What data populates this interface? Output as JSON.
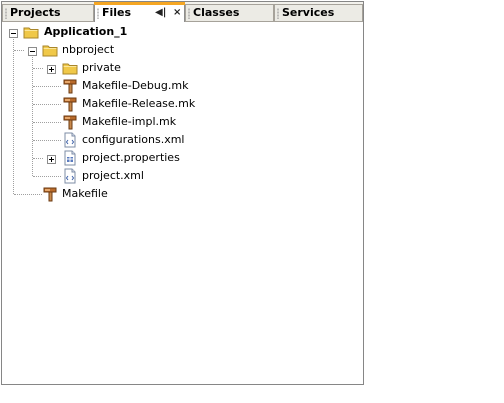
{
  "tabs": [
    {
      "label": "Projects",
      "active": false
    },
    {
      "label": "Files",
      "active": true
    },
    {
      "label": "Classes",
      "active": false
    },
    {
      "label": "Services",
      "active": false
    }
  ],
  "tab_controls": {
    "minimize_glyph": "◀|",
    "close_glyph": "×"
  },
  "tree": {
    "root": "Application_1",
    "nbproject": "nbproject",
    "private": "private",
    "makefile_debug": "Makefile-Debug.mk",
    "makefile_release": "Makefile-Release.mk",
    "makefile_impl": "Makefile-impl.mk",
    "configurations": "configurations.xml",
    "project_properties": "project.properties",
    "project_xml": "project.xml",
    "makefile": "Makefile"
  },
  "colors": {
    "active_tab_accent": "#f5a623",
    "folder": "#f0c848",
    "panel_border": "#868686"
  },
  "icons": {
    "folder": "folder-icon",
    "makefile": "makefile-icon",
    "xml": "xml-file-icon",
    "properties": "properties-file-icon"
  }
}
